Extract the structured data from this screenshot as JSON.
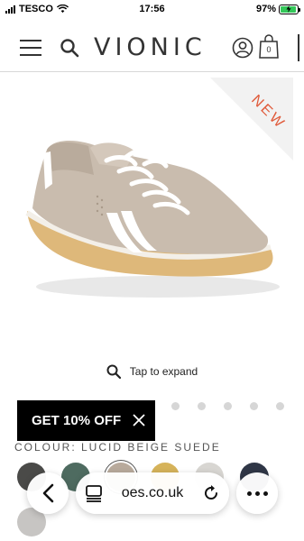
{
  "status_bar": {
    "carrier": "TESCO",
    "time": "17:56",
    "battery_percent": "97%",
    "battery_level": 0.97,
    "battery_color": "#34c759"
  },
  "header": {
    "brand": "VIONIC",
    "menu_icon": "hamburger-icon",
    "search_icon": "search-icon",
    "account_icon": "account-icon",
    "bag_icon": "shopping-bag-icon",
    "bag_count": "0"
  },
  "product": {
    "badge": "NEW",
    "badge_color": "#e05a3a",
    "tap_to_expand": "Tap to expand",
    "image_icon": "sneaker-image"
  },
  "promo": {
    "label": "GET 10% OFF",
    "close_icon": "close-icon"
  },
  "gallery": {
    "dots": 5
  },
  "colour": {
    "label": "COLOUR: LUCID BEIGE SUEDE",
    "swatches": [
      {
        "name": "dark-grey",
        "color": "#4a4a48",
        "selected": false
      },
      {
        "name": "teal-green",
        "color": "#4e6b60",
        "selected": false
      },
      {
        "name": "lucid-beige",
        "color": "#b8aa9c",
        "selected": true
      },
      {
        "name": "mustard",
        "color": "#d6b35a",
        "selected": false
      },
      {
        "name": "light-grey",
        "color": "#d8d6d2",
        "selected": false
      },
      {
        "name": "navy",
        "color": "#2f3646",
        "selected": false
      },
      {
        "name": "pale-grey",
        "color": "#c7c5c3",
        "selected": false
      }
    ]
  },
  "browser": {
    "url": "oes.co.uk",
    "back_icon": "chevron-left-icon",
    "tabs_icon": "tabs-icon",
    "reload_icon": "reload-icon",
    "more_icon": "more-icon"
  }
}
